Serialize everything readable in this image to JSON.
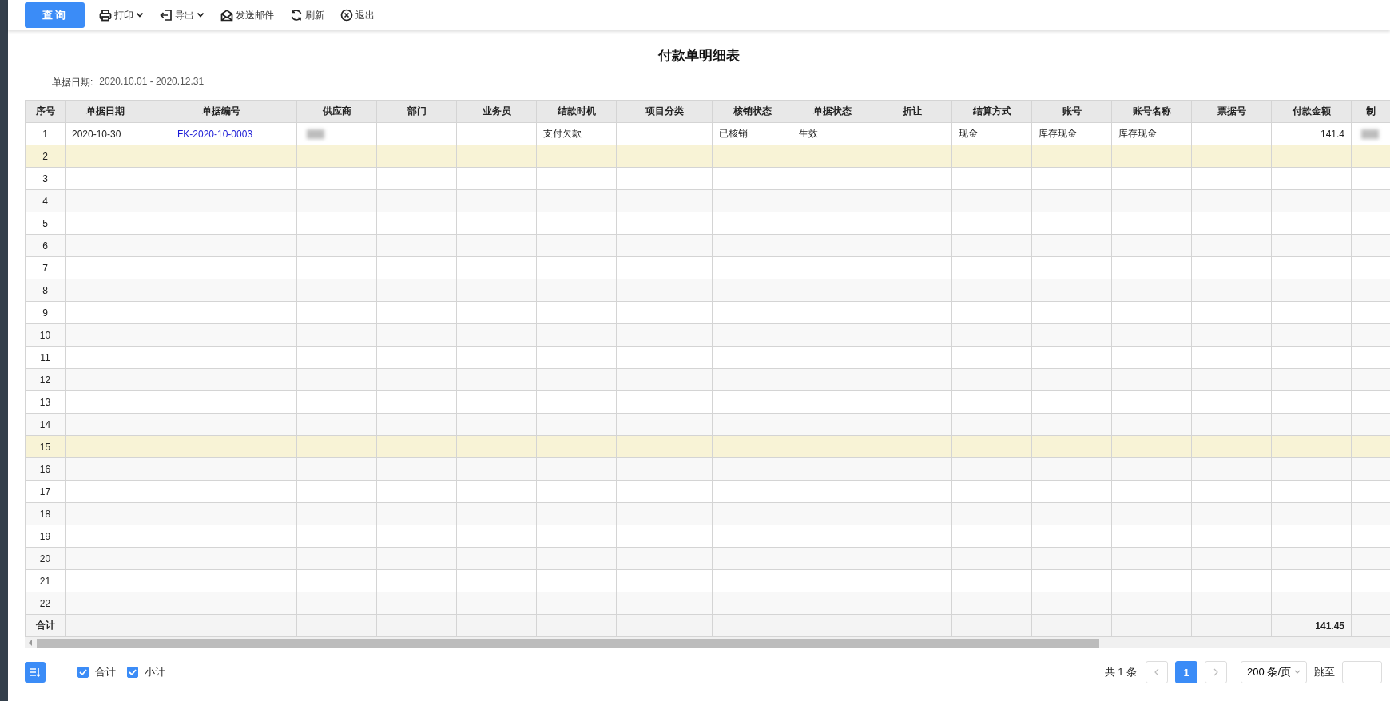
{
  "toolbar": {
    "items": [
      {
        "label": "查询",
        "kind": "primary",
        "dropdown": false
      },
      {
        "label": "打印",
        "kind": "action",
        "dropdown": true
      },
      {
        "label": "导出",
        "kind": "action",
        "dropdown": true
      },
      {
        "label": "发送邮件",
        "kind": "action",
        "dropdown": false
      },
      {
        "label": "刷新",
        "kind": "action",
        "dropdown": false
      },
      {
        "label": "退出",
        "kind": "action",
        "dropdown": false
      }
    ]
  },
  "report": {
    "title": "付款单明细表",
    "date_label": "单据日期:",
    "date_range": "2020.10.01 - 2020.12.31"
  },
  "table": {
    "columns": [
      "序号",
      "单据日期",
      "单据编号",
      "供应商",
      "部门",
      "业务员",
      "结款时机",
      "项目分类",
      "核销状态",
      "单据状态",
      "折让",
      "结算方式",
      "账号",
      "账号名称",
      "票据号",
      "付款金额",
      "制"
    ],
    "rows": [
      {
        "number": "1",
        "highlighted": false,
        "cells": [
          {
            "kind": "text",
            "text": "2020-10-30"
          },
          {
            "kind": "link",
            "text": "FK-2020-10-0003"
          },
          {
            "kind": "redacted"
          },
          null,
          null,
          {
            "kind": "text",
            "text": "支付欠款"
          },
          null,
          {
            "kind": "text",
            "text": "已核销"
          },
          {
            "kind": "text",
            "text": "生效"
          },
          null,
          {
            "kind": "text",
            "text": "现金"
          },
          {
            "kind": "text",
            "text": "库存现金"
          },
          {
            "kind": "text",
            "text": "库存现金"
          },
          null,
          {
            "kind": "amount",
            "text": "141.4"
          },
          {
            "kind": "redacted"
          }
        ]
      },
      {
        "number": "2",
        "highlighted": true
      },
      {
        "number": "3",
        "highlighted": false
      },
      {
        "number": "4",
        "highlighted": false
      },
      {
        "number": "5",
        "highlighted": false
      },
      {
        "number": "6",
        "highlighted": false
      },
      {
        "number": "7",
        "highlighted": false
      },
      {
        "number": "8",
        "highlighted": false
      },
      {
        "number": "9",
        "highlighted": false
      },
      {
        "number": "10",
        "highlighted": false
      },
      {
        "number": "11",
        "highlighted": false
      },
      {
        "number": "12",
        "highlighted": false
      },
      {
        "number": "13",
        "highlighted": false
      },
      {
        "number": "14",
        "highlighted": false
      },
      {
        "number": "15",
        "highlighted": true
      },
      {
        "number": "16",
        "highlighted": false
      },
      {
        "number": "17",
        "highlighted": false
      },
      {
        "number": "18",
        "highlighted": false
      },
      {
        "number": "19",
        "highlighted": false
      },
      {
        "number": "20",
        "highlighted": false
      },
      {
        "number": "21",
        "highlighted": false
      },
      {
        "number": "22",
        "highlighted": false
      }
    ],
    "footer": {
      "label": "合计",
      "cells": [
        null,
        null,
        null,
        null,
        null,
        null,
        null,
        null,
        null,
        null,
        null,
        null,
        null,
        null,
        {
          "kind": "amount",
          "text": "141.45"
        },
        null
      ]
    }
  },
  "options": [
    {
      "label": "合计",
      "checked": true
    },
    {
      "label": "小计",
      "checked": true
    }
  ],
  "pagination": {
    "total": "共 1 条",
    "pages": [
      {
        "label": "1",
        "selected": true
      }
    ],
    "page_size": "200 条/页",
    "jump_label": "跳至"
  }
}
